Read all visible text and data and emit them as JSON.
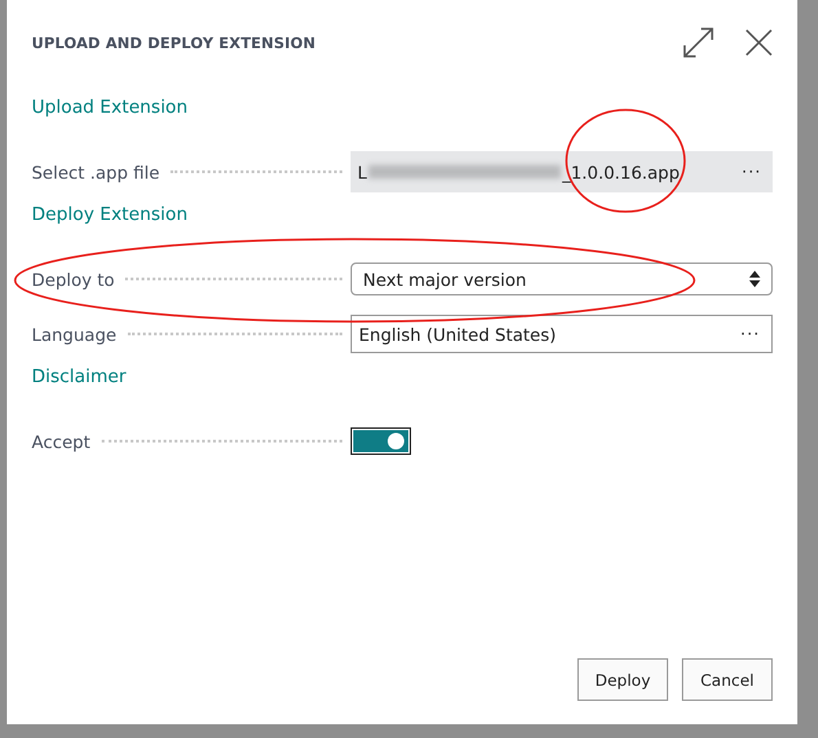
{
  "dialog": {
    "title": "UPLOAD AND DEPLOY EXTENSION"
  },
  "sections": [
    {
      "heading": "Upload Extension",
      "fields": [
        {
          "kind": "file",
          "label": "Select .app file",
          "value_start": "L",
          "value_end": "_1.0.0.16.app",
          "button": "···"
        }
      ]
    },
    {
      "heading": "Deploy Extension",
      "fields": [
        {
          "kind": "select",
          "label": "Deploy to",
          "value": "Next major version"
        },
        {
          "kind": "lookup",
          "label": "Language",
          "value": "English (United States)",
          "button": "···"
        }
      ]
    },
    {
      "heading": "Disclaimer",
      "fields": [
        {
          "kind": "toggle",
          "label": "Accept",
          "on": true
        }
      ]
    }
  ],
  "buttons": [
    "Deploy",
    "Cancel"
  ]
}
